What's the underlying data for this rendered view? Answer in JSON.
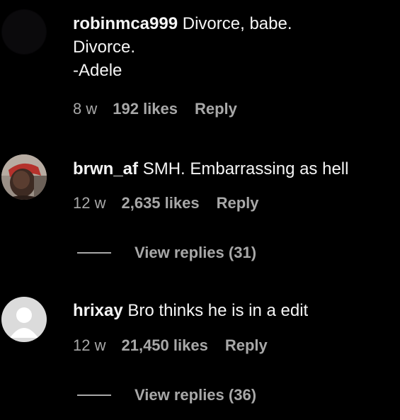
{
  "comments": [
    {
      "username": "robinmca999",
      "lines": [
        "Divorce, babe.",
        "Divorce.",
        "-Adele"
      ],
      "age": "8 w",
      "likes": "192 likes",
      "reply": "Reply"
    },
    {
      "username": "brwn_af",
      "lines": [
        "SMH. Embarrassing as hell"
      ],
      "age": "12 w",
      "likes": "2,635 likes",
      "reply": "Reply",
      "view_replies": "View replies (31)"
    },
    {
      "username": "hrixay",
      "lines": [
        "Bro thinks he is in a edit"
      ],
      "age": "12 w",
      "likes": "21,450 likes",
      "reply": "Reply",
      "view_replies": "View replies (36)"
    }
  ],
  "colors": {
    "background": "#000000",
    "primary_text": "#f5f5f5",
    "secondary_text": "#a8a8a8",
    "default_avatar_bg": "#dbdbdb"
  },
  "icons": {
    "avatar_1": "user-photo-icon",
    "avatar_2": "user-photo-icon",
    "avatar_3": "default-avatar-icon"
  }
}
